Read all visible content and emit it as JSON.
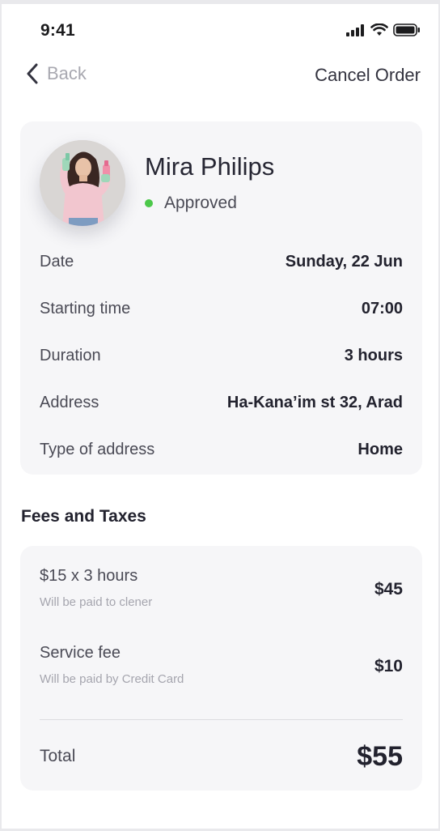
{
  "status_bar": {
    "time": "9:41"
  },
  "nav": {
    "back_label": "Back",
    "cancel_label": "Cancel Order"
  },
  "provider": {
    "name": "Mira Philips",
    "status": "Approved",
    "status_color": "#4cc84a"
  },
  "details": [
    {
      "label": "Date",
      "value": "Sunday, 22 Jun"
    },
    {
      "label": "Starting time",
      "value": "07:00"
    },
    {
      "label": "Duration",
      "value": "3 hours"
    },
    {
      "label": "Address",
      "value": "Ha-Kana’im st 32, Arad"
    },
    {
      "label": "Type of address",
      "value": "Home"
    }
  ],
  "fees": {
    "title": "Fees and Taxes",
    "items": [
      {
        "label": "$15 x 3 hours",
        "note": "Will be paid to clener",
        "amount": "$45"
      },
      {
        "label": "Service fee",
        "note": "Will be paid by Credit Card",
        "amount": "$10"
      }
    ],
    "total_label": "Total",
    "total_value": "$55"
  }
}
